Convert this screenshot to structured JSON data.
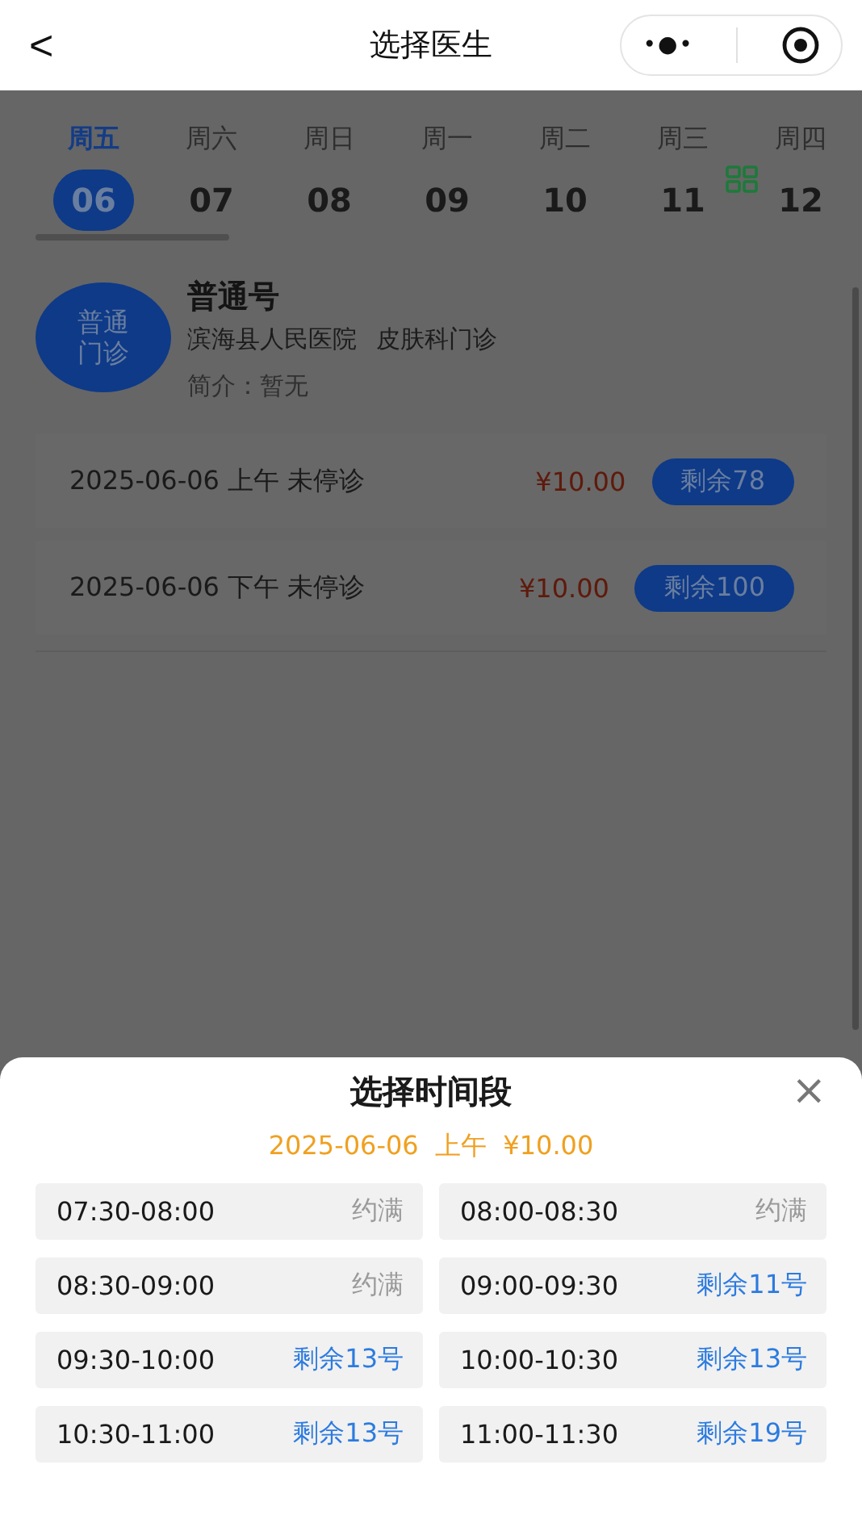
{
  "nav": {
    "back": "<",
    "title": "选择医生",
    "more": "•●•"
  },
  "days": [
    {
      "weekday": "周五",
      "date": "06",
      "selected": true
    },
    {
      "weekday": "周六",
      "date": "07",
      "selected": false
    },
    {
      "weekday": "周日",
      "date": "08",
      "selected": false
    },
    {
      "weekday": "周一",
      "date": "09",
      "selected": false
    },
    {
      "weekday": "周二",
      "date": "10",
      "selected": false
    },
    {
      "weekday": "周三",
      "date": "11",
      "selected": false
    },
    {
      "weekday": "周四",
      "date": "12",
      "selected": false
    }
  ],
  "doctor": {
    "avatar": "普通门诊",
    "name": "普通号",
    "hospital": "滨海县人民医院",
    "department": "皮肤科门诊",
    "intro": "简介：暂无"
  },
  "schedules": [
    {
      "session": "2025-06-06 上午 未停诊",
      "price": "¥10.00",
      "remaining": "剩余78"
    },
    {
      "session": "2025-06-06 下午 未停诊",
      "price": "¥10.00",
      "remaining": "剩余100"
    }
  ],
  "sheet": {
    "title": "选择时间段",
    "close": "×",
    "subtitle": "2025-06-06  上午  ¥10.00",
    "slots": [
      {
        "time": "07:30-08:00",
        "status": "约满",
        "kind": "full"
      },
      {
        "time": "08:00-08:30",
        "status": "约满",
        "kind": "full"
      },
      {
        "time": "08:30-09:00",
        "status": "约满",
        "kind": "full"
      },
      {
        "time": "09:00-09:30",
        "status": "剩余11号",
        "kind": "available"
      },
      {
        "time": "09:30-10:00",
        "status": "剩余13号",
        "kind": "available"
      },
      {
        "time": "10:00-10:30",
        "status": "剩余13号",
        "kind": "available"
      },
      {
        "time": "10:30-11:00",
        "status": "剩余13号",
        "kind": "available"
      },
      {
        "time": "11:00-11:30",
        "status": "剩余19号",
        "kind": "available"
      }
    ]
  }
}
